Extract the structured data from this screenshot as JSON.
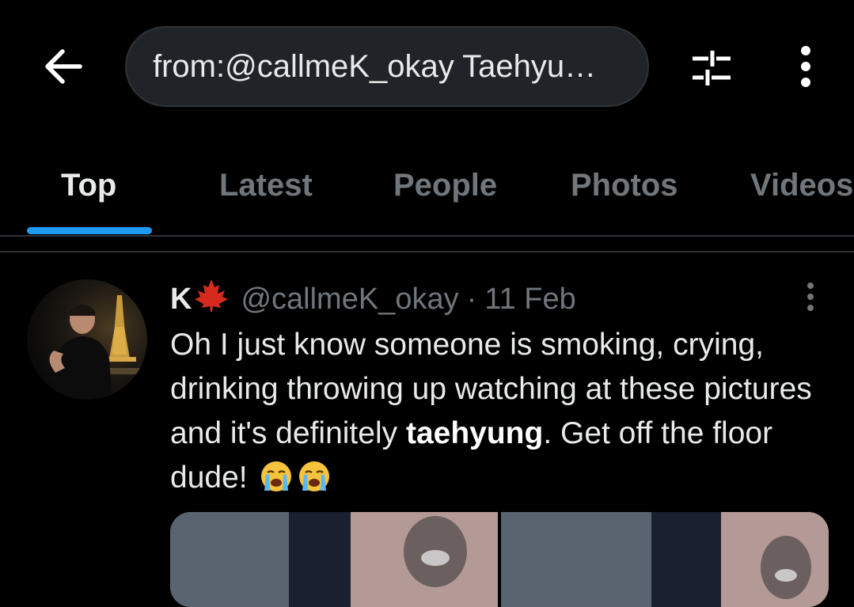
{
  "search": {
    "query": "from:@callmeK_okay Taehyu…"
  },
  "icons": {
    "back": "back-arrow-icon",
    "filter": "filter-sliders-icon",
    "more": "more-vertical-icon"
  },
  "tabs": [
    {
      "label": "Top",
      "active": true
    },
    {
      "label": "Latest",
      "active": false
    },
    {
      "label": "People",
      "active": false
    },
    {
      "label": "Photos",
      "active": false
    },
    {
      "label": "Videos",
      "active": false
    }
  ],
  "colors": {
    "accent": "#1d9bf0",
    "background": "#000000",
    "muted_text": "#71767b",
    "primary_text": "#e7e9ea"
  },
  "tweet": {
    "display_name": "K",
    "flag_icon": "maple-leaf-icon",
    "handle": "@callmeK_okay",
    "separator": "·",
    "date": "11 Feb",
    "text_part1": "Oh I just know someone is smoking, crying, drinking throwing up watching at these pictures and it's definitely ",
    "text_bold": "taehyung",
    "text_part2": ". Get off the floor dude! ",
    "emojis": [
      "loudly-crying-face-icon",
      "loudly-crying-face-icon"
    ],
    "media_count": 2
  }
}
